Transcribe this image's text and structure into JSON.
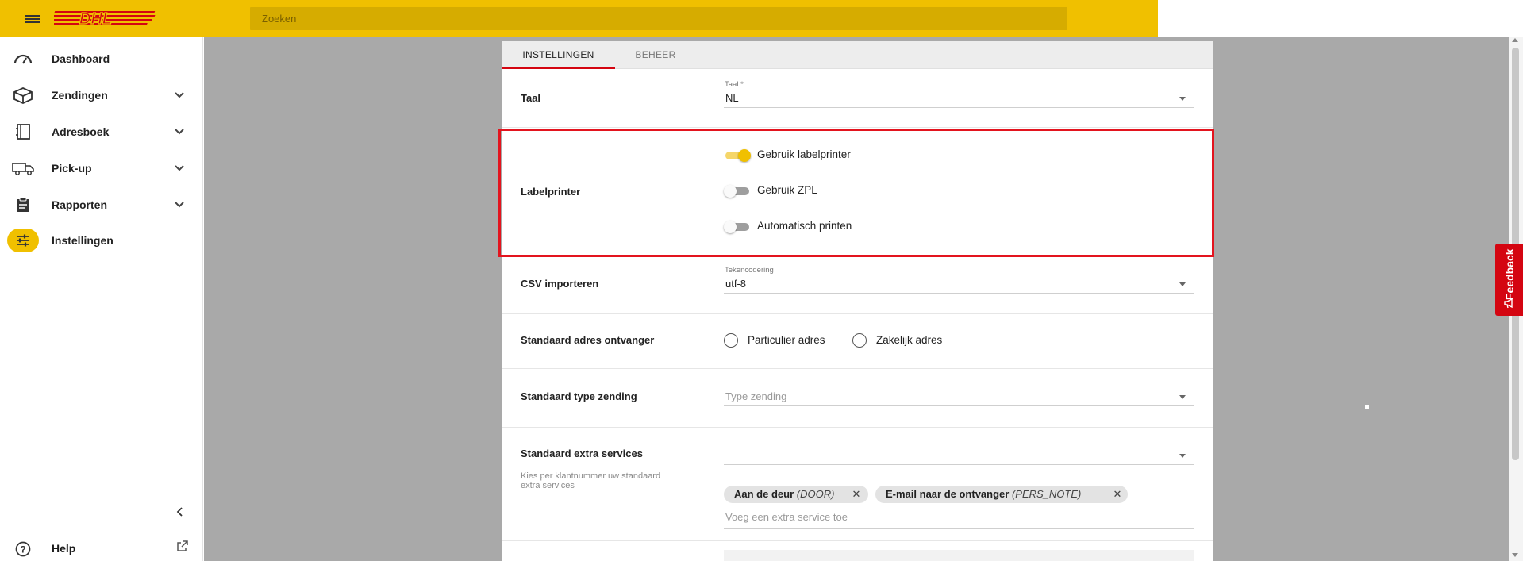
{
  "header": {
    "brand": "DHL",
    "search_placeholder": "Zoeken"
  },
  "sidebar": {
    "items": [
      {
        "label": "Dashboard",
        "icon": "speedometer-icon",
        "has_chevron": false
      },
      {
        "label": "Zendingen",
        "icon": "package-icon",
        "has_chevron": true
      },
      {
        "label": "Adresboek",
        "icon": "address-book-icon",
        "has_chevron": true
      },
      {
        "label": "Pick-up",
        "icon": "truck-icon",
        "has_chevron": true
      },
      {
        "label": "Rapporten",
        "icon": "clipboard-icon",
        "has_chevron": true
      },
      {
        "label": "Instellingen",
        "icon": "sliders-icon",
        "has_chevron": false,
        "active": true
      }
    ],
    "help_label": "Help"
  },
  "tabs": [
    {
      "label": "INSTELLINGEN",
      "active": true
    },
    {
      "label": "BEHEER",
      "active": false
    }
  ],
  "settings": {
    "taal": {
      "label": "Taal",
      "field_label": "Taal *",
      "value": "NL"
    },
    "labelprinter": {
      "label": "Labelprinter",
      "toggles": [
        {
          "label": "Gebruik labelprinter",
          "on": true
        },
        {
          "label": "Gebruik ZPL",
          "on": false
        },
        {
          "label": "Automatisch printen",
          "on": false
        }
      ]
    },
    "csv": {
      "label": "CSV importeren",
      "field_label": "Tekencodering",
      "value": "utf-8"
    },
    "adres": {
      "label": "Standaard adres ontvanger",
      "options": [
        "Particulier adres",
        "Zakelijk adres"
      ]
    },
    "type_zending": {
      "label": "Standaard type zending",
      "placeholder": "Type zending"
    },
    "extra_services": {
      "label": "Standaard extra services",
      "hint": "Kies per klantnummer uw standaard extra services",
      "chips": [
        {
          "name": "Aan de deur",
          "code": "(DOOR)"
        },
        {
          "name": "E-mail naar de ontvanger",
          "code": "(PERS_NOTE)"
        }
      ],
      "add_placeholder": "Voeg een extra service toe"
    }
  },
  "feedback": {
    "label": "Feedback"
  },
  "colors": {
    "brand_yellow": "#f0c000",
    "brand_red": "#d40511",
    "highlight_red": "#e3141e"
  }
}
